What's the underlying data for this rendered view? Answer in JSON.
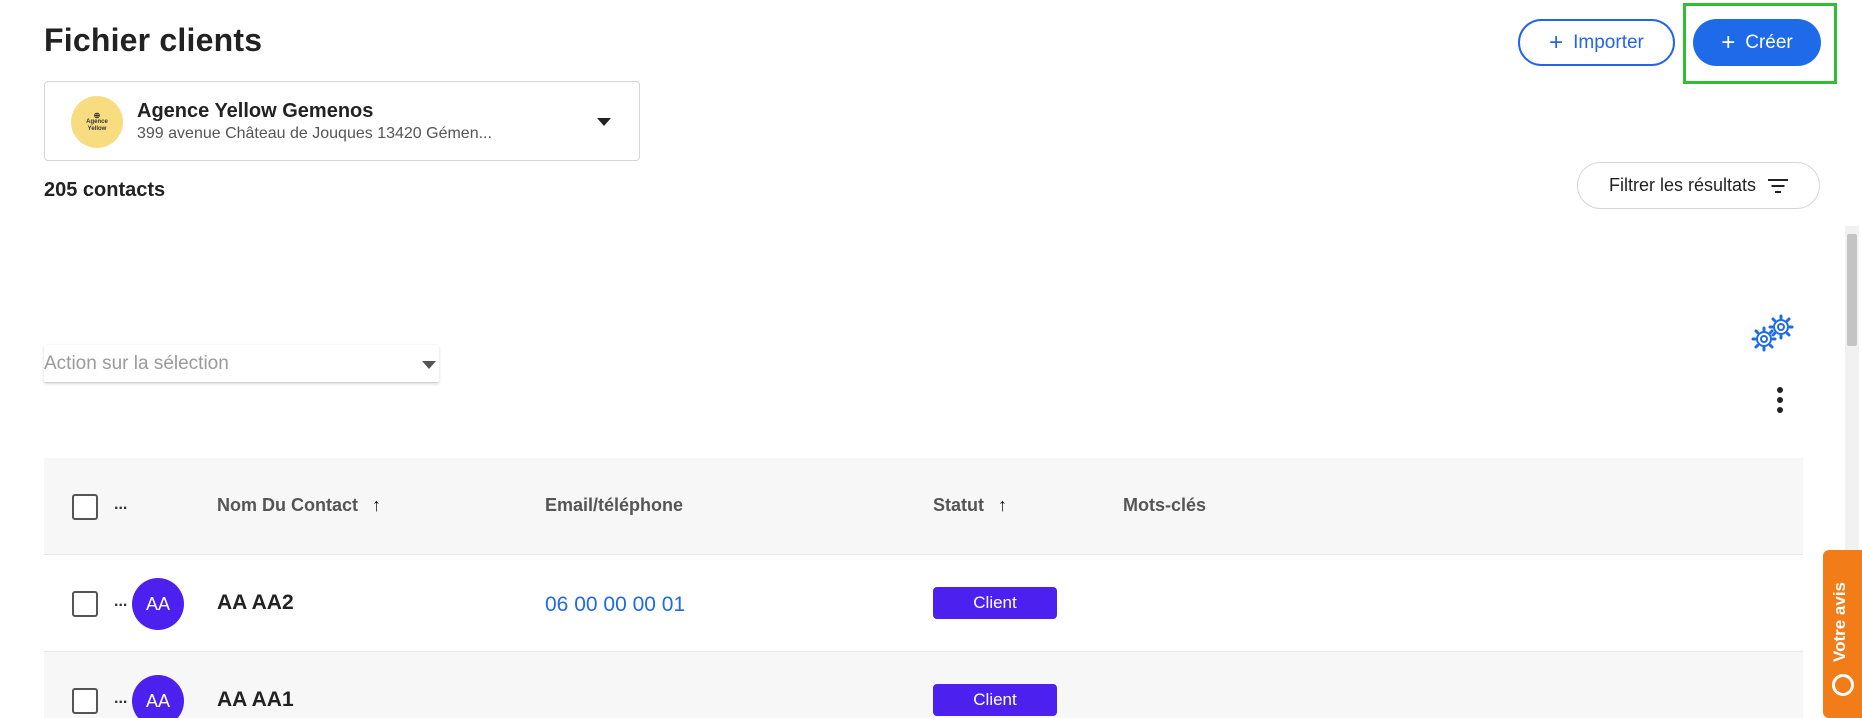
{
  "page": {
    "title": "Fichier clients"
  },
  "header": {
    "import_label": "Importer",
    "create_label": "Créer"
  },
  "agency": {
    "logo_line1": "Agence",
    "logo_line2": "Yellow",
    "name": "Agence Yellow Gemenos",
    "address": "399 avenue Château de Jouques 13420 Gémen..."
  },
  "contacts": {
    "count_label": "205 contacts"
  },
  "filter": {
    "label": "Filtrer les résultats"
  },
  "actions": {
    "placeholder": "Action sur la sélection"
  },
  "table": {
    "headers": {
      "dots": "...",
      "name": "Nom Du Contact",
      "contact": "Email/téléphone",
      "status": "Statut",
      "keywords": "Mots-clés"
    },
    "rows": [
      {
        "dots": "...",
        "initials": "AA",
        "name": "AA AA2",
        "phone": "06 00 00 00 01",
        "status": "Client"
      },
      {
        "dots": "...",
        "initials": "AA",
        "name": "AA AA1",
        "phone": "",
        "status": "Client"
      }
    ]
  },
  "feedback": {
    "label": "Votre avis"
  },
  "colors": {
    "primary": "#1e6ae8",
    "avatar": "#4c21f0",
    "status_badge": "#4c21f0",
    "feedback": "#f27c17",
    "highlight": "#2fbf2f",
    "logo_bg": "#f7dd80"
  },
  "icons": [
    "plus-icon",
    "chevron-down-icon",
    "filter-icon",
    "gears-icon",
    "kebab-menu-icon",
    "sort-up-arrow-icon",
    "chat-icon"
  ]
}
